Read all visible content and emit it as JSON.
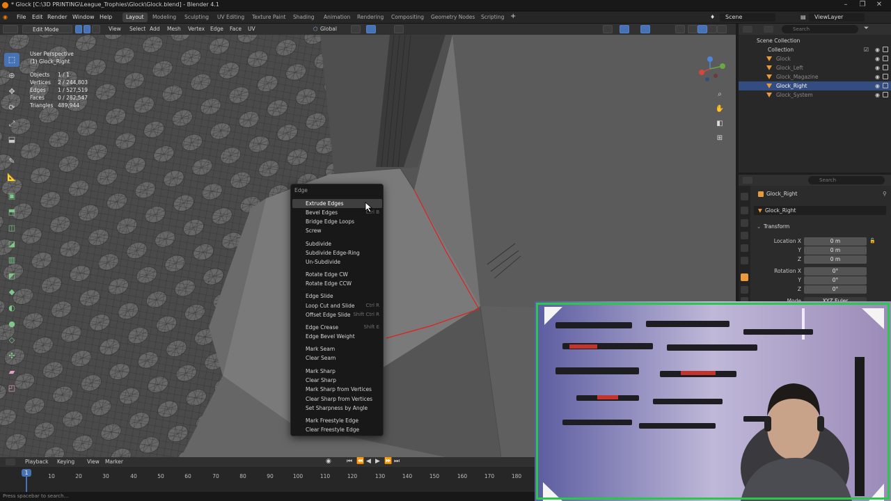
{
  "window": {
    "title": "* Glock [C:\\3D PRINTING\\League_Trophies\\Glock\\Glock.blend] - Blender 4.1",
    "controls": [
      "–",
      "❐",
      "✕"
    ]
  },
  "menubar": {
    "items": [
      "File",
      "Edit",
      "Render",
      "Window",
      "Help"
    ],
    "workspaces": [
      "Layout",
      "Modeling",
      "Sculpting",
      "UV Editing",
      "Texture Paint",
      "Shading",
      "Animation",
      "Rendering",
      "Compositing",
      "Geometry Nodes",
      "Scripting"
    ],
    "active_workspace": "Layout",
    "add_tab": "+",
    "scene": "Scene",
    "view_layer": "ViewLayer"
  },
  "header3d": {
    "mode": "Edit Mode",
    "menus": [
      "View",
      "Select",
      "Add",
      "Mesh",
      "Vertex",
      "Edge",
      "Face",
      "UV"
    ],
    "orientation": "Global",
    "options": "Options",
    "axes": [
      "X",
      "Y",
      "Z"
    ]
  },
  "overlay": {
    "view_name": "User Perspective",
    "object_name": "(1) Glock_Right",
    "stats": [
      {
        "label": "Objects",
        "value": "1 / 1"
      },
      {
        "label": "Vertices",
        "value": "2 / 244,803"
      },
      {
        "label": "Edges",
        "value": "1 / 527,519"
      },
      {
        "label": "Faces",
        "value": "0 / 282,547"
      },
      {
        "label": "Triangles",
        "value": "489,944"
      }
    ]
  },
  "context_menu": {
    "title": "Edge",
    "items": [
      {
        "label": "Extrude Edges",
        "shortcut": ""
      },
      {
        "label": "Bevel Edges",
        "shortcut": "Ctrl B"
      },
      {
        "label": "Bridge Edge Loops",
        "shortcut": ""
      },
      {
        "label": "Screw",
        "shortcut": ""
      },
      {
        "label": "Subdivide",
        "shortcut": ""
      },
      {
        "label": "Subdivide Edge-Ring",
        "shortcut": ""
      },
      {
        "label": "Un-Subdivide",
        "shortcut": ""
      },
      {
        "label": "Rotate Edge CW",
        "shortcut": ""
      },
      {
        "label": "Rotate Edge CCW",
        "shortcut": ""
      },
      {
        "label": "Edge Slide",
        "shortcut": ""
      },
      {
        "label": "Loop Cut and Slide",
        "shortcut": "Ctrl R"
      },
      {
        "label": "Offset Edge Slide",
        "shortcut": "Shift Ctrl R"
      },
      {
        "label": "Edge Crease",
        "shortcut": "Shift E"
      },
      {
        "label": "Edge Bevel Weight",
        "shortcut": ""
      },
      {
        "label": "Mark Seam",
        "shortcut": ""
      },
      {
        "label": "Clear Seam",
        "shortcut": ""
      },
      {
        "label": "Mark Sharp",
        "shortcut": ""
      },
      {
        "label": "Clear Sharp",
        "shortcut": ""
      },
      {
        "label": "Mark Sharp from Vertices",
        "shortcut": ""
      },
      {
        "label": "Clear Sharp from Vertices",
        "shortcut": ""
      },
      {
        "label": "Set Sharpness by Angle",
        "shortcut": ""
      },
      {
        "label": "Mark Freestyle Edge",
        "shortcut": ""
      },
      {
        "label": "Clear Freestyle Edge",
        "shortcut": ""
      }
    ]
  },
  "outliner": {
    "search_placeholder": "Search",
    "scene_collection": "Scene Collection",
    "collection": "Collection",
    "objects": [
      "Glock",
      "Glock_Left",
      "Glock_Magazine",
      "Glock_Right",
      "Glock_System"
    ],
    "selected": "Glock_Right"
  },
  "properties": {
    "search_placeholder": "Search",
    "object_name": "Glock_Right",
    "object_field": "Glock_Right",
    "panel": "Transform",
    "location_label": "Location X",
    "rotation_label": "Rotation X",
    "location": [
      "0 m",
      "0 m",
      "0 m"
    ],
    "rotation": [
      "0°",
      "0°",
      "0°"
    ],
    "mode_label": "Mode",
    "mode_value": "XYZ Euler",
    "axis_y": "Y",
    "axis_z": "Z"
  },
  "timeline": {
    "menus": [
      "Playback",
      "Keying",
      "View",
      "Marker"
    ],
    "current_frame": "1",
    "ticks": [
      "10",
      "20",
      "30",
      "40",
      "50",
      "60",
      "70",
      "80",
      "90",
      "100",
      "110",
      "120",
      "130",
      "140",
      "150",
      "160",
      "170",
      "180"
    ]
  },
  "statusbar": {
    "text": "Press spacebar to search..."
  },
  "colors": {
    "accent": "#4772b3",
    "selected_edge": "#e0201c",
    "webcam_border": "#29c84d",
    "menu_bg": "#181818"
  }
}
